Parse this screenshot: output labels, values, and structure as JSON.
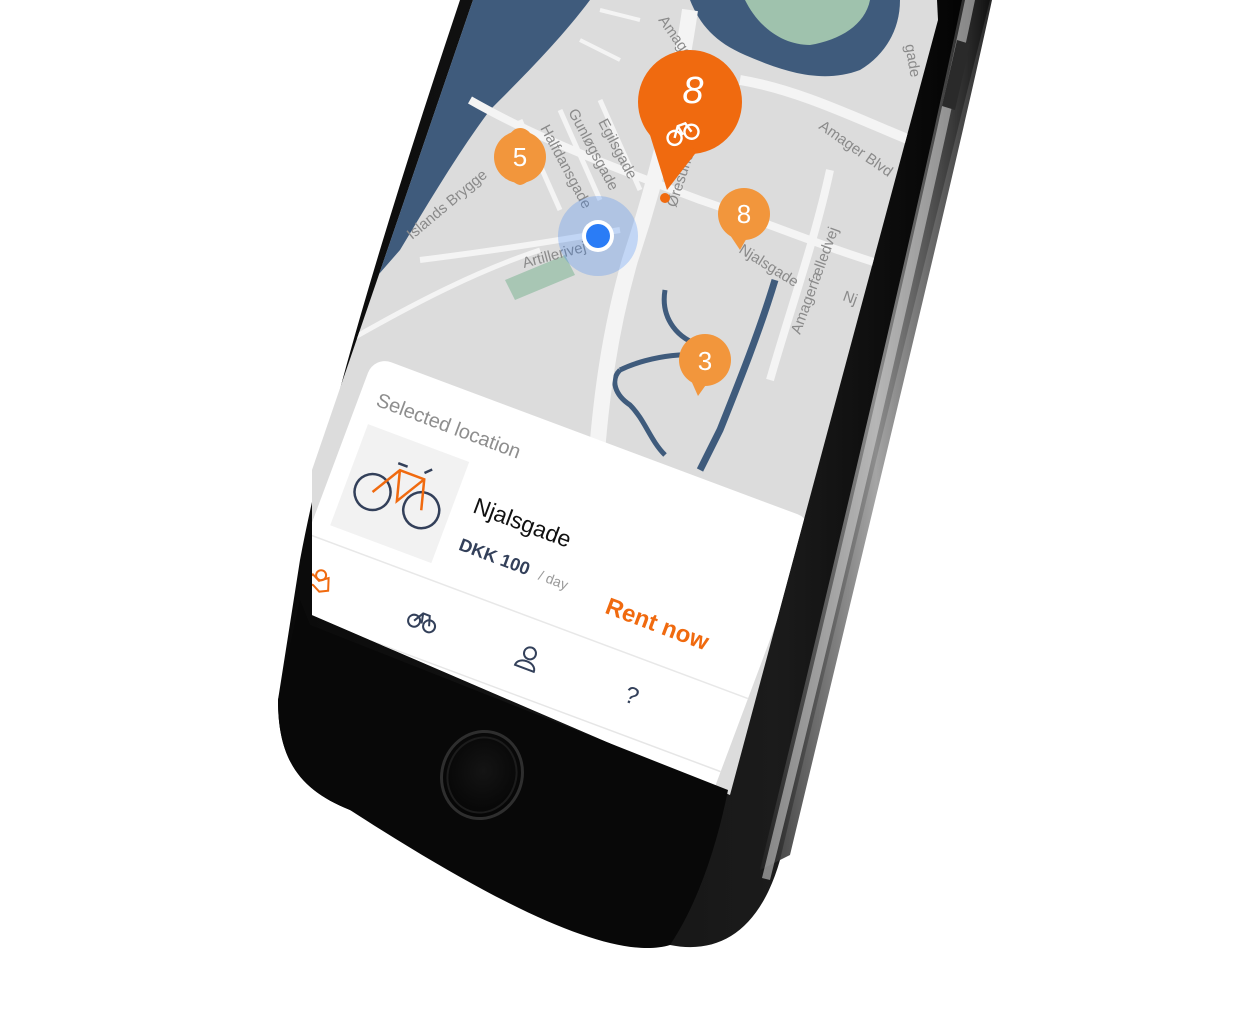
{
  "map": {
    "streets": [
      "Amager",
      "Amager Blvd",
      "Egilsgade",
      "Gunløgsgade",
      "Halfdansgade",
      "Islands Brygge",
      "Artillerivej",
      "Øresundsvej",
      "Njalsgade",
      "Amagerfælledvej",
      "Nj",
      "gade"
    ],
    "clusters": [
      {
        "count": "8",
        "kind": "large"
      },
      {
        "count": "5",
        "kind": "small"
      },
      {
        "count": "8",
        "kind": "small"
      },
      {
        "count": "3",
        "kind": "small"
      }
    ],
    "colors": {
      "land": "#dcdcdc",
      "water": "#3f5b7c",
      "park": "#9fc2ad",
      "pin_primary": "#f06a0f",
      "pin_secondary": "#f2963c",
      "user": "#2a7cf6"
    }
  },
  "panel": {
    "header": "Selected location",
    "location_name": "Njalsgade",
    "price": "DKK 100",
    "price_unit": "/ day",
    "rent_button": "Rent now",
    "accent": "#f06a0f"
  },
  "tabbar": [
    {
      "icon": "map-icon",
      "active": true
    },
    {
      "icon": "bike-icon",
      "active": false
    },
    {
      "icon": "profile-icon",
      "active": false
    },
    {
      "icon": "help-icon",
      "glyph": "?",
      "active": false
    }
  ]
}
